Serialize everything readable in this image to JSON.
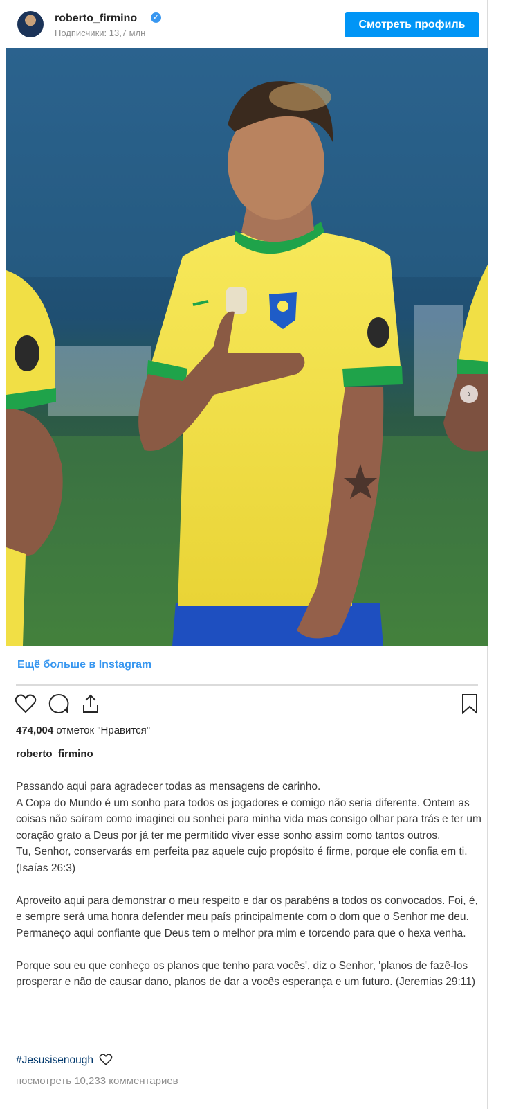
{
  "header": {
    "username": "roberto_firmino",
    "subscribers": "Подписчики: 13,7 млн",
    "view_profile_label": "Смотреть профиль"
  },
  "photo": {
    "carousel_dots": 2,
    "active_dot": 0
  },
  "more_link": "Ещё больше в Instagram",
  "actions": {
    "icons": [
      "heart-icon",
      "comment-icon",
      "share-icon",
      "bookmark-icon"
    ]
  },
  "likes": {
    "count": "474,004",
    "label": " отметок \"Нравится\""
  },
  "author": "roberto_firmino",
  "caption": {
    "paragraphs": [
      "Passando aqui para agradecer todas as mensagens de carinho.\nA Copa do Mundo é um sonho para todos os jogadores e comigo não seria diferente. Ontem as coisas não saíram como imaginei ou sonhei para minha vida mas consigo olhar para trás e ter um coração grato a Deus por já ter me permitido viver esse sonho assim como tantos outros.\nTu, Senhor, conservarás em perfeita paz aquele cujo propósito é firme, porque ele confia em ti. (Isaías 26:3)",
      "Aproveito aqui para demonstrar o meu respeito e dar os parabéns a todos os convocados. Foi, é, e sempre será uma honra defender meu país principalmente com o dom que o Senhor me deu. Permaneço aqui confiante que Deus tem o melhor pra mim e torcendo para que o hexa venha.",
      "Porque sou eu que conheço os planos que tenho para vocês', diz o Senhor, 'planos de fazê-los prosperar e não de causar dano, planos de dar a vocês esperança e um futuro. (Jeremias 29:11)"
    ],
    "hashtag": "#Jesusisenough"
  },
  "comments_link": "посмотреть 10,233 комментариев",
  "colors": {
    "accent": "#0095f6",
    "link": "#3897f0",
    "jersey_yellow": "#f4e24a",
    "collar_green": "#1fa34a",
    "shorts_blue": "#1e4fc0"
  }
}
